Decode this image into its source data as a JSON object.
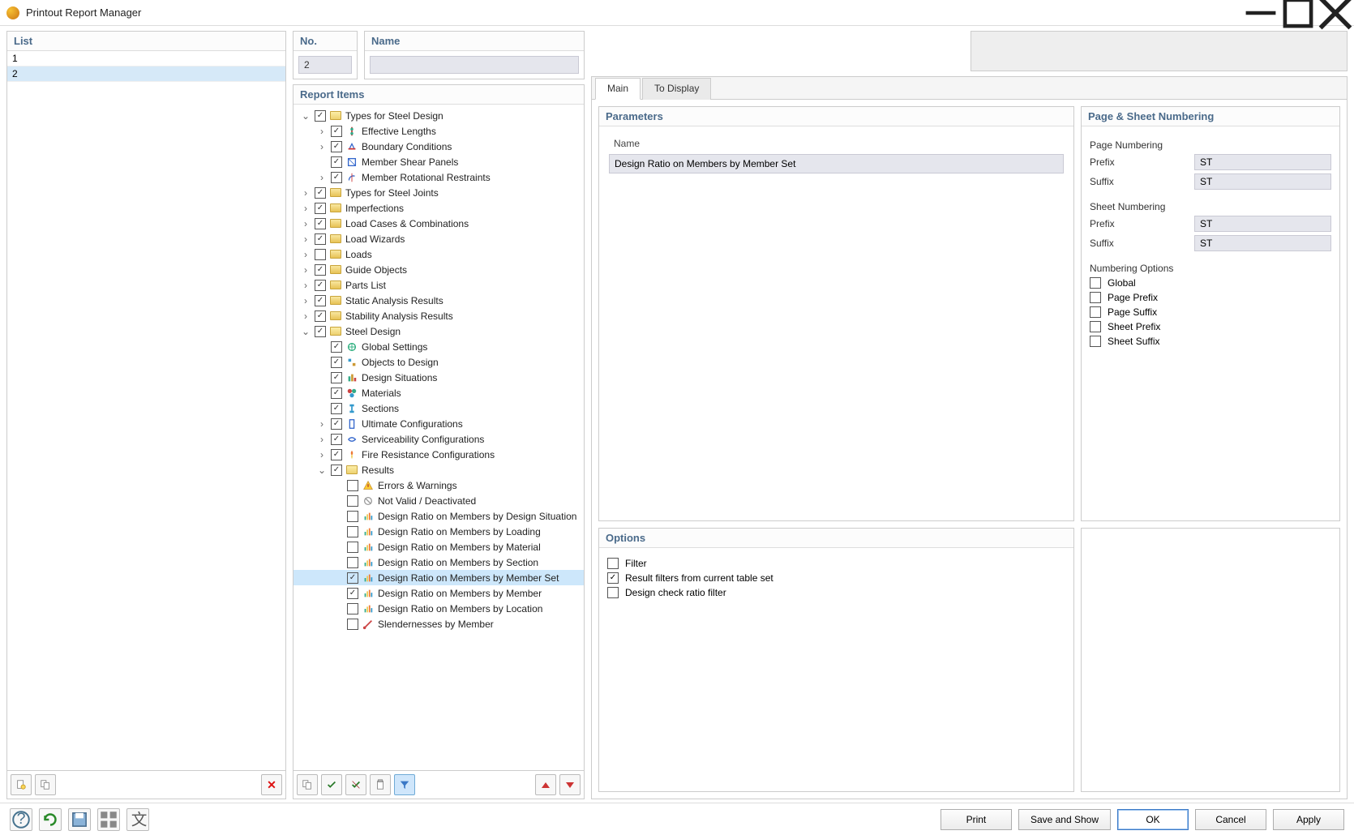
{
  "window": {
    "title": "Printout Report Manager"
  },
  "list": {
    "header": "List",
    "items": [
      "1",
      "2"
    ],
    "selected_index": 1
  },
  "no_field": {
    "label": "No.",
    "value": "2"
  },
  "name_field": {
    "label": "Name",
    "value": ""
  },
  "report_items_header": "Report Items",
  "tree": [
    {
      "level": 0,
      "exp": "v",
      "chk": true,
      "icon": "folder-open",
      "label": "Types for Steel Design"
    },
    {
      "level": 1,
      "exp": ">",
      "chk": true,
      "icon": "eff",
      "label": "Effective Lengths"
    },
    {
      "level": 1,
      "exp": ">",
      "chk": true,
      "icon": "bc",
      "label": "Boundary Conditions"
    },
    {
      "level": 1,
      "exp": "",
      "chk": true,
      "icon": "msp",
      "label": "Member Shear Panels"
    },
    {
      "level": 1,
      "exp": ">",
      "chk": true,
      "icon": "mrr",
      "label": "Member Rotational Restraints"
    },
    {
      "level": 0,
      "exp": ">",
      "chk": true,
      "icon": "folder",
      "label": "Types for Steel Joints"
    },
    {
      "level": 0,
      "exp": ">",
      "chk": true,
      "icon": "folder",
      "label": "Imperfections"
    },
    {
      "level": 0,
      "exp": ">",
      "chk": true,
      "icon": "folder",
      "label": "Load Cases & Combinations"
    },
    {
      "level": 0,
      "exp": ">",
      "chk": true,
      "icon": "folder",
      "label": "Load Wizards"
    },
    {
      "level": 0,
      "exp": ">",
      "chk": false,
      "icon": "folder",
      "label": "Loads"
    },
    {
      "level": 0,
      "exp": ">",
      "chk": true,
      "icon": "folder",
      "label": "Guide Objects"
    },
    {
      "level": 0,
      "exp": ">",
      "chk": true,
      "icon": "folder",
      "label": "Parts List"
    },
    {
      "level": 0,
      "exp": ">",
      "chk": true,
      "icon": "folder",
      "label": "Static Analysis Results"
    },
    {
      "level": 0,
      "exp": ">",
      "chk": true,
      "icon": "folder",
      "label": "Stability Analysis Results"
    },
    {
      "level": 0,
      "exp": "v",
      "chk": true,
      "icon": "folder-open",
      "label": "Steel Design"
    },
    {
      "level": 1,
      "exp": "",
      "chk": true,
      "icon": "gs",
      "label": "Global Settings"
    },
    {
      "level": 1,
      "exp": "",
      "chk": true,
      "icon": "od",
      "label": "Objects to Design"
    },
    {
      "level": 1,
      "exp": "",
      "chk": true,
      "icon": "ds",
      "label": "Design Situations"
    },
    {
      "level": 1,
      "exp": "",
      "chk": true,
      "icon": "mat",
      "label": "Materials"
    },
    {
      "level": 1,
      "exp": "",
      "chk": true,
      "icon": "sec",
      "label": "Sections"
    },
    {
      "level": 1,
      "exp": ">",
      "chk": true,
      "icon": "uc",
      "label": "Ultimate Configurations"
    },
    {
      "level": 1,
      "exp": ">",
      "chk": true,
      "icon": "sc",
      "label": "Serviceability Configurations"
    },
    {
      "level": 1,
      "exp": ">",
      "chk": true,
      "icon": "fr",
      "label": "Fire Resistance Configurations"
    },
    {
      "level": 1,
      "exp": "v",
      "chk": true,
      "icon": "folder-open",
      "label": "Results"
    },
    {
      "level": 2,
      "exp": "",
      "chk": false,
      "icon": "ew",
      "label": "Errors & Warnings"
    },
    {
      "level": 2,
      "exp": "",
      "chk": false,
      "icon": "nv",
      "label": "Not Valid / Deactivated"
    },
    {
      "level": 2,
      "exp": "",
      "chk": false,
      "icon": "dr",
      "label": "Design Ratio on Members by Design Situation"
    },
    {
      "level": 2,
      "exp": "",
      "chk": false,
      "icon": "dr",
      "label": "Design Ratio on Members by Loading"
    },
    {
      "level": 2,
      "exp": "",
      "chk": false,
      "icon": "dr",
      "label": "Design Ratio on Members by Material"
    },
    {
      "level": 2,
      "exp": "",
      "chk": false,
      "icon": "dr",
      "label": "Design Ratio on Members by Section"
    },
    {
      "level": 2,
      "exp": "",
      "chk": true,
      "icon": "dr",
      "label": "Design Ratio on Members by Member Set",
      "selected": true
    },
    {
      "level": 2,
      "exp": "",
      "chk": true,
      "icon": "dr",
      "label": "Design Ratio on Members by Member"
    },
    {
      "level": 2,
      "exp": "",
      "chk": false,
      "icon": "dr",
      "label": "Design Ratio on Members by Location"
    },
    {
      "level": 2,
      "exp": "",
      "chk": false,
      "icon": "sl",
      "label": "Slendernesses by Member"
    }
  ],
  "tabs": {
    "main": "Main",
    "to_display": "To Display",
    "active": "main"
  },
  "parameters": {
    "header": "Parameters",
    "col_name": "Name",
    "row_value": "Design Ratio on Members by Member Set"
  },
  "options": {
    "header": "Options",
    "filter": {
      "label": "Filter",
      "checked": false
    },
    "result_filters": {
      "label": "Result filters from current table set",
      "checked": true
    },
    "design_check": {
      "label": "Design check ratio filter",
      "checked": false
    }
  },
  "numbering": {
    "header": "Page & Sheet Numbering",
    "page_numbering_label": "Page Numbering",
    "sheet_numbering_label": "Sheet Numbering",
    "prefix_label": "Prefix",
    "suffix_label": "Suffix",
    "page_prefix": "ST",
    "page_suffix": "ST",
    "sheet_prefix": "ST",
    "sheet_suffix": "ST",
    "options_label": "Numbering Options",
    "opts": [
      {
        "label": "Global",
        "checked": false
      },
      {
        "label": "Page Prefix",
        "checked": false
      },
      {
        "label": "Page Suffix",
        "checked": false
      },
      {
        "label": "Sheet Prefix",
        "checked": false
      },
      {
        "label": "Sheet Suffix",
        "checked": false
      }
    ]
  },
  "footer_buttons": {
    "print": "Print",
    "save_show": "Save and Show",
    "ok": "OK",
    "cancel": "Cancel",
    "apply": "Apply"
  }
}
